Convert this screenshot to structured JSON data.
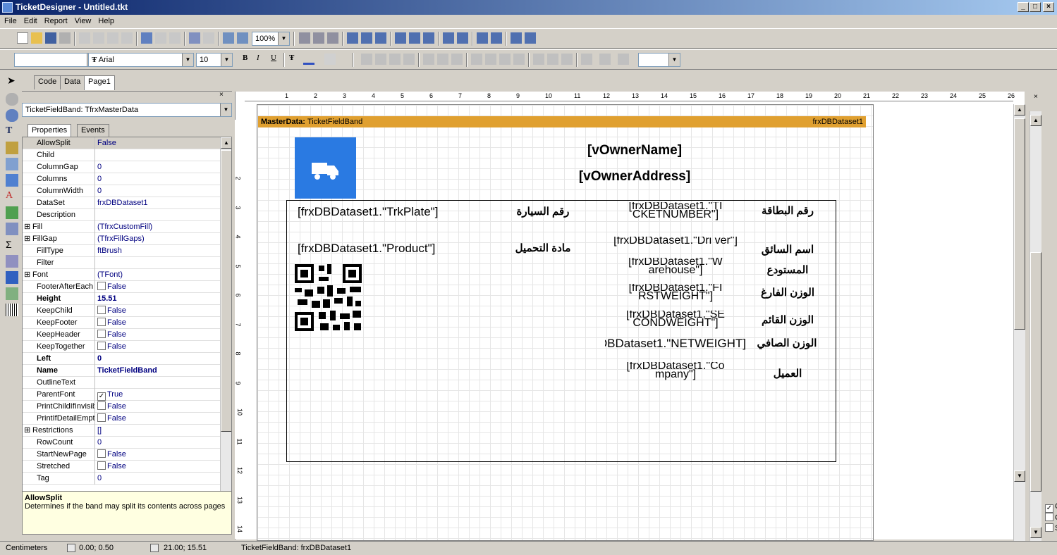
{
  "window": {
    "title": "TicketDesigner - Untitled.tkt",
    "min": "_",
    "max": "□",
    "close": "×"
  },
  "menu": [
    "File",
    "Edit",
    "Report",
    "View",
    "Help"
  ],
  "toolbar1": {
    "zoom": "100%"
  },
  "toolbar2": {
    "font": "Arial",
    "size": "10"
  },
  "tabs": [
    "Code",
    "Data",
    "Page1"
  ],
  "inspector": {
    "object": "TicketFieldBand: TfrxMasterData",
    "tabs": [
      "Properties",
      "Events"
    ],
    "props": [
      {
        "n": "AllowSplit",
        "v": "False"
      },
      {
        "n": "Child",
        "v": ""
      },
      {
        "n": "ColumnGap",
        "v": "0"
      },
      {
        "n": "Columns",
        "v": "0"
      },
      {
        "n": "ColumnWidth",
        "v": "0"
      },
      {
        "n": "DataSet",
        "v": "frxDBDataset1"
      },
      {
        "n": "Description",
        "v": ""
      },
      {
        "n": "Fill",
        "v": "(TfrxCustomFill)"
      },
      {
        "n": "FillGap",
        "v": "(TfrxFillGaps)"
      },
      {
        "n": "FillType",
        "v": "ftBrush"
      },
      {
        "n": "Filter",
        "v": ""
      },
      {
        "n": "Font",
        "v": "(TFont)"
      },
      {
        "n": "FooterAfterEach",
        "v": "False"
      },
      {
        "n": "Height",
        "v": "15.51"
      },
      {
        "n": "KeepChild",
        "v": "False"
      },
      {
        "n": "KeepFooter",
        "v": "False"
      },
      {
        "n": "KeepHeader",
        "v": "False"
      },
      {
        "n": "KeepTogether",
        "v": "False"
      },
      {
        "n": "Left",
        "v": "0"
      },
      {
        "n": "Name",
        "v": "TicketFieldBand"
      },
      {
        "n": "OutlineText",
        "v": ""
      },
      {
        "n": "ParentFont",
        "v": "True"
      },
      {
        "n": "PrintChildIfInvisible",
        "v": "False"
      },
      {
        "n": "PrintIfDetailEmpty",
        "v": "False"
      },
      {
        "n": "Restrictions",
        "v": "[]"
      },
      {
        "n": "RowCount",
        "v": "0"
      },
      {
        "n": "StartNewPage",
        "v": "False"
      },
      {
        "n": "Stretched",
        "v": "False"
      },
      {
        "n": "Tag",
        "v": "0"
      }
    ],
    "help_title": "AllowSplit",
    "help_text": "Determines if the band may split its contents across pages"
  },
  "band": {
    "label": "MasterData:",
    "name": "TicketFieldBand",
    "dataset": "frxDBDataset1"
  },
  "ticket": {
    "owner_name": "[vOwnerName]",
    "owner_address": "[vOwnerAddress]",
    "trk_plate": "[frxDBDataset1.\"TrkPlate\"]",
    "product": "[frxDBDataset1.\"Product\"]",
    "lbl_plate": "رقم السيارة",
    "lbl_product": "مادة التحميل",
    "lbl_ticket": "رقم البطاقة",
    "lbl_driver": "اسم السائق",
    "lbl_warehouse": "المستودع",
    "lbl_empty": "الوزن الفارغ",
    "lbl_full": "الوزن القائم",
    "lbl_net": "الوزن الصافي",
    "lbl_client": "العميل",
    "f_ticket": "[frxDBDataset1.\"TI CKETNUMBER\"]",
    "f_driver": "[frxDBDataset1.\"Dri ver\"]",
    "f_warehouse": "[frxDBDataset1.\"W arehouse\"]",
    "f_first": "[frxDBDataset1.\"FI RSTWEIGHT\"]",
    "f_second": "[frxDBDataset1.\"SE CONDWEIGHT\"]",
    "f_net": "[frxDBDataset1.\"NETWEIGHT\"]",
    "f_company": "[frxDBDataset1.\"Co mpany\"]"
  },
  "ruler": [
    "1",
    "2",
    "3",
    "4",
    "5",
    "6",
    "7",
    "8",
    "9",
    "10",
    "11",
    "12",
    "13",
    "14",
    "15",
    "16",
    "17",
    "18",
    "19",
    "20",
    "21",
    "22",
    "23",
    "24",
    "25",
    "26"
  ],
  "ruler_left": [
    "2",
    "3",
    "4",
    "5",
    "6",
    "7",
    "8",
    "9",
    "10",
    "11",
    "12",
    "13",
    "14"
  ],
  "status": {
    "units": "Centimeters",
    "pos": "0.00; 0.50",
    "size": "21.00; 15.51",
    "band": "TicketFieldBand: frxDBDataset1"
  },
  "right_checks": [
    "C",
    "C",
    "S"
  ]
}
